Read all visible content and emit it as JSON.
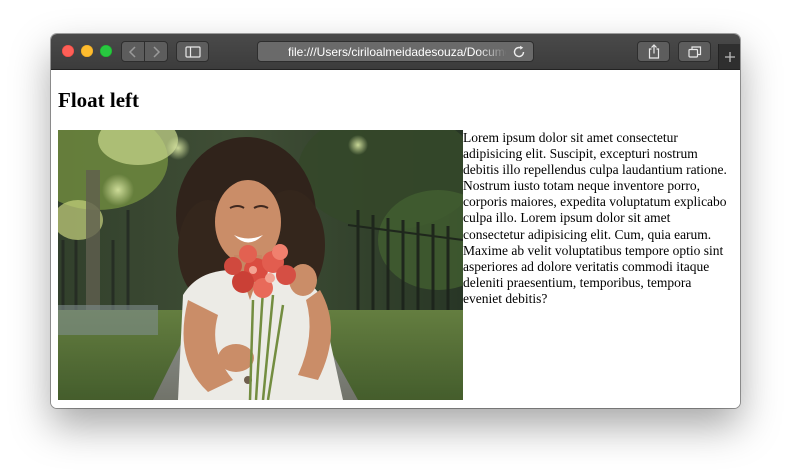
{
  "browser": {
    "address": "file:///Users/ciriloalmeidadesouza/Documents/index.html",
    "buttons": {
      "back": "chevron-left-icon",
      "forward": "chevron-right-icon",
      "sidebar": "sidebar-icon",
      "reload": "reload-icon",
      "share": "share-icon",
      "tabs": "tabs-overview-icon",
      "new_tab": "plus-icon"
    }
  },
  "page": {
    "heading": "Float left",
    "image_alt": "Woman smiling holding a bouquet of red flowers",
    "paragraph": "Lorem ipsum dolor sit amet consectetur adipisicing elit. Suscipit, excepturi nostrum debitis illo repellendus culpa laudantium ratione. Nostrum iusto totam neque inventore porro, corporis maiores, expedita voluptatum explicabo culpa illo. Lorem ipsum dolor sit amet consectetur adipisicing elit. Cum, quia earum. Maxime ab velit voluptatibus tempore optio sint asperiores ad dolore veritatis commodi itaque deleniti praesentium, temporibus, tempora eveniet debitis?"
  },
  "colors": {
    "titlebar": "#3c3c3c",
    "close": "#fe5f57",
    "minimize": "#febc2e",
    "zoom": "#28c840"
  }
}
